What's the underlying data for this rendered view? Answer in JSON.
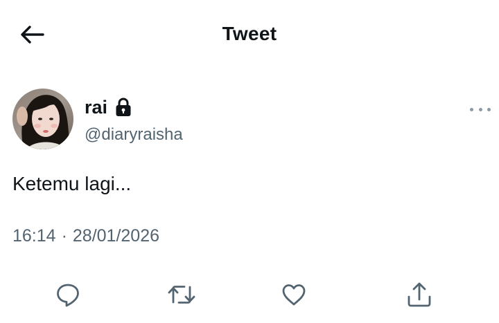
{
  "header": {
    "title": "Tweet",
    "back_icon": "arrow-left-icon"
  },
  "author": {
    "display_name": "rai",
    "handle": "@diaryraisha",
    "protected_icon": "lock-icon",
    "avatar_icon": "avatar-photo"
  },
  "tweet": {
    "text": "Ketemu lagi...",
    "time": "16:14",
    "separator": "·",
    "date": "28/01/2026"
  },
  "actions": [
    {
      "name": "reply",
      "icon": "reply-icon"
    },
    {
      "name": "retweet",
      "icon": "retweet-icon"
    },
    {
      "name": "like",
      "icon": "heart-icon"
    },
    {
      "name": "share",
      "icon": "share-icon"
    }
  ],
  "colors": {
    "primary_text": "#0f1419",
    "secondary_text": "#536471",
    "icon_gray": "#536471",
    "more_dots": "#8b98a5",
    "background": "#ffffff"
  }
}
